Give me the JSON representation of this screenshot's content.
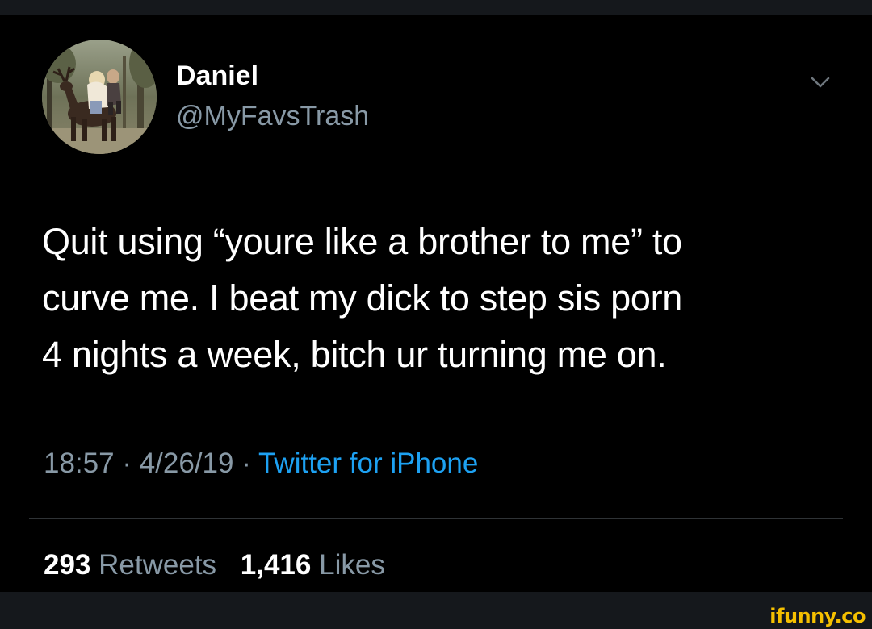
{
  "user": {
    "display_name": "Daniel",
    "handle": "@MyFavsTrash"
  },
  "tweet": {
    "lines": [
      "Quit using “youre like a brother to me” to",
      "curve me. I beat my dick to step sis porn",
      "4 nights a week, bitch ur turning me on."
    ]
  },
  "meta": {
    "time": "18:57",
    "separator": " · ",
    "date": "4/26/19",
    "source": "Twitter for iPhone"
  },
  "stats": {
    "retweets_count": "293",
    "retweets_label": "Retweets",
    "likes_count": "1,416",
    "likes_label": "Likes"
  },
  "icons": {
    "caret": "chevron-down-icon"
  },
  "colors": {
    "background": "#000000",
    "secondary_text": "#8899a6",
    "link": "#1da1f2",
    "watermark": "#f5c000"
  },
  "watermark": "ifunny.co"
}
